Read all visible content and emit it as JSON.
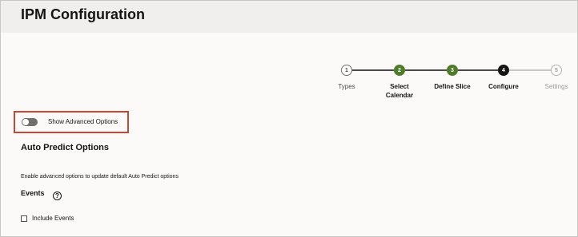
{
  "page": {
    "title": "IPM Configuration"
  },
  "stepper": {
    "steps": [
      {
        "number": "1",
        "label": "Types",
        "state": "visited"
      },
      {
        "number": "2",
        "label": "Select Calendar",
        "state": "complete"
      },
      {
        "number": "3",
        "label": "Define Slice",
        "state": "complete"
      },
      {
        "number": "4",
        "label": "Configure",
        "state": "current"
      },
      {
        "number": "5",
        "label": "Settings",
        "state": "future"
      }
    ]
  },
  "advanced": {
    "toggle_label": "Show Advanced Options",
    "enabled": false
  },
  "auto_predict": {
    "title": "Auto Predict Options",
    "helper": "Enable advanced options to update default Auto Predict options"
  },
  "events": {
    "label": "Events",
    "help_icon": "?",
    "checkbox_label": "Include Events",
    "checked": false
  },
  "colors": {
    "complete": "#4f7c29",
    "current": "#161513",
    "highlight": "#c74634"
  }
}
